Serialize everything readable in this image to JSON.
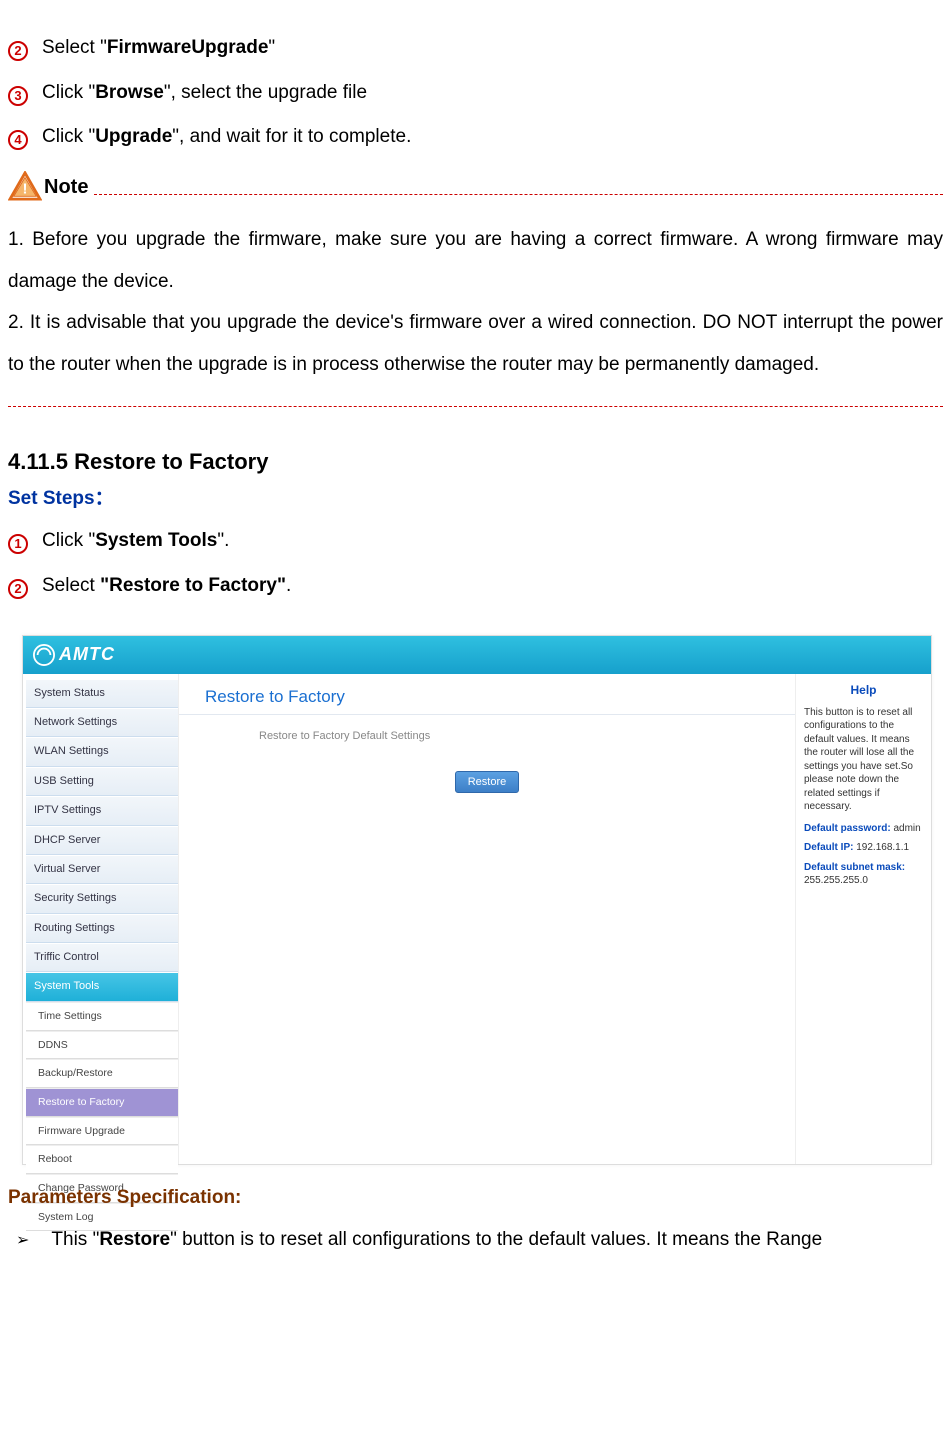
{
  "steps_top": [
    {
      "num": "2",
      "before": "Select \"",
      "bold": "FirmwareUpgrade",
      "after": "\""
    },
    {
      "num": "3",
      "before": "Click \"",
      "bold": "Browse",
      "after": "\", select the upgrade file"
    },
    {
      "num": "4",
      "before": "Click \"",
      "bold": "Upgrade",
      "after": "\", and wait for it to complete."
    }
  ],
  "note": {
    "label": "Note",
    "p1": "1. Before you upgrade the firmware, make sure you are having a correct firmware. A wrong firmware may damage the device.",
    "p2": "2. It is advisable that you upgrade the device's firmware over a wired connection. DO NOT interrupt the power to the router when the upgrade is in process otherwise the router may be permanently damaged."
  },
  "section": {
    "title": "4.11.5 Restore to Factory",
    "set_steps_label": "Set Steps：",
    "steps": [
      {
        "num": "1",
        "before": "Click \"",
        "bold": "System Tools",
        "after": "\"."
      },
      {
        "num": "2",
        "before": "Select ",
        "bold": "\"Restore to Factory\"",
        "after": "."
      }
    ]
  },
  "screenshot": {
    "brand": "AMTC",
    "nav_main": [
      "System Status",
      "Network Settings",
      "WLAN Settings",
      "USB Setting",
      "IPTV Settings",
      "DHCP Server",
      "Virtual Server",
      "Security Settings",
      "Routing Settings",
      "Triffic Control",
      "System Tools"
    ],
    "nav_active_main": "System Tools",
    "nav_sub": [
      "Time Settings",
      "DDNS",
      "Backup/Restore",
      "Restore to Factory",
      "Firmware Upgrade",
      "Reboot",
      "Change Password",
      "System Log"
    ],
    "nav_active_sub": "Restore to Factory",
    "pane_title": "Restore to Factory",
    "pane_subtext": "Restore to Factory Default Settings",
    "restore_button": "Restore",
    "help": {
      "title": "Help",
      "body": "This button is to reset all configurations to the default values. It means the router will lose all the settings you have set.So please note down the related settings if necessary.",
      "default_password_label": "Default password:",
      "default_password_value": " admin",
      "default_ip_label": "Default IP:",
      "default_ip_value": " 192.168.1.1",
      "default_mask_label": "Default subnet mask:",
      "default_mask_value": "255.255.255.0"
    }
  },
  "params": {
    "heading": "Parameters Specification:",
    "bullet_glyph": "➢",
    "bullet_before": "This \"",
    "bullet_bold": "Restore",
    "bullet_after": "\" button is to reset all configurations to the default values. It means the Range"
  }
}
